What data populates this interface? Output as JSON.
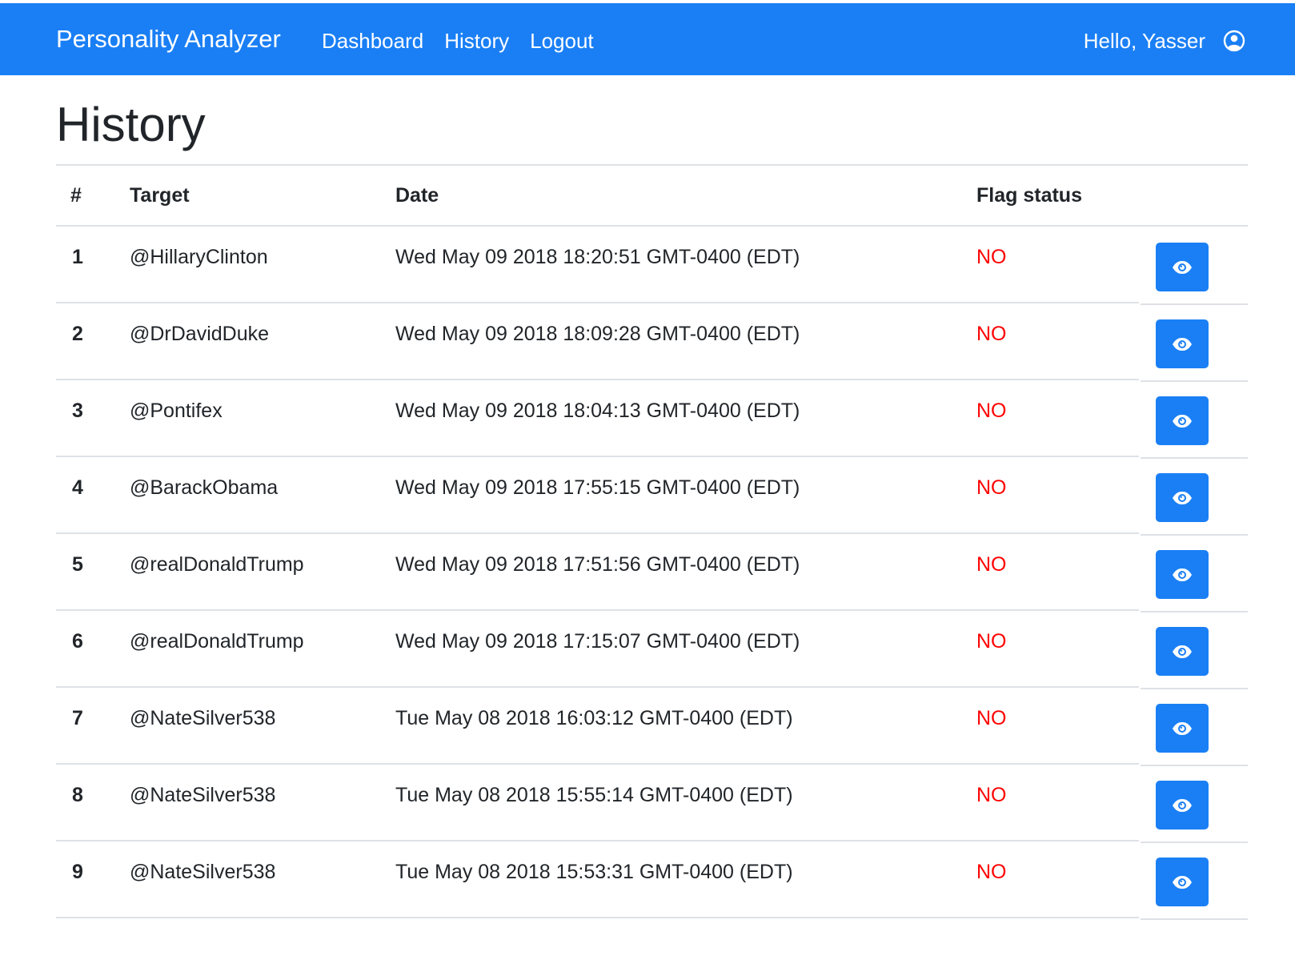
{
  "navbar": {
    "brand": "Personality Analyzer",
    "links": [
      {
        "label": "Dashboard"
      },
      {
        "label": "History"
      },
      {
        "label": "Logout"
      }
    ],
    "greeting": "Hello, Yasser",
    "user_icon": "user-circle-icon",
    "background_color": "#1a7ff5"
  },
  "page": {
    "title": "History"
  },
  "table": {
    "headers": {
      "num": "#",
      "target": "Target",
      "date": "Date",
      "flag": "Flag status"
    },
    "action_icon": "eye-icon",
    "flag_color": "#ff0000",
    "rows": [
      {
        "num": "1",
        "target": "@HillaryClinton",
        "date": "Wed May 09 2018 18:20:51 GMT-0400 (EDT)",
        "flag": "NO"
      },
      {
        "num": "2",
        "target": "@DrDavidDuke",
        "date": "Wed May 09 2018 18:09:28 GMT-0400 (EDT)",
        "flag": "NO"
      },
      {
        "num": "3",
        "target": "@Pontifex",
        "date": "Wed May 09 2018 18:04:13 GMT-0400 (EDT)",
        "flag": "NO"
      },
      {
        "num": "4",
        "target": "@BarackObama",
        "date": "Wed May 09 2018 17:55:15 GMT-0400 (EDT)",
        "flag": "NO"
      },
      {
        "num": "5",
        "target": "@realDonaldTrump",
        "date": "Wed May 09 2018 17:51:56 GMT-0400 (EDT)",
        "flag": "NO"
      },
      {
        "num": "6",
        "target": "@realDonaldTrump",
        "date": "Wed May 09 2018 17:15:07 GMT-0400 (EDT)",
        "flag": "NO"
      },
      {
        "num": "7",
        "target": "@NateSilver538",
        "date": "Tue May 08 2018 16:03:12 GMT-0400 (EDT)",
        "flag": "NO"
      },
      {
        "num": "8",
        "target": "@NateSilver538",
        "date": "Tue May 08 2018 15:55:14 GMT-0400 (EDT)",
        "flag": "NO"
      },
      {
        "num": "9",
        "target": "@NateSilver538",
        "date": "Tue May 08 2018 15:53:31 GMT-0400 (EDT)",
        "flag": "NO"
      }
    ]
  }
}
